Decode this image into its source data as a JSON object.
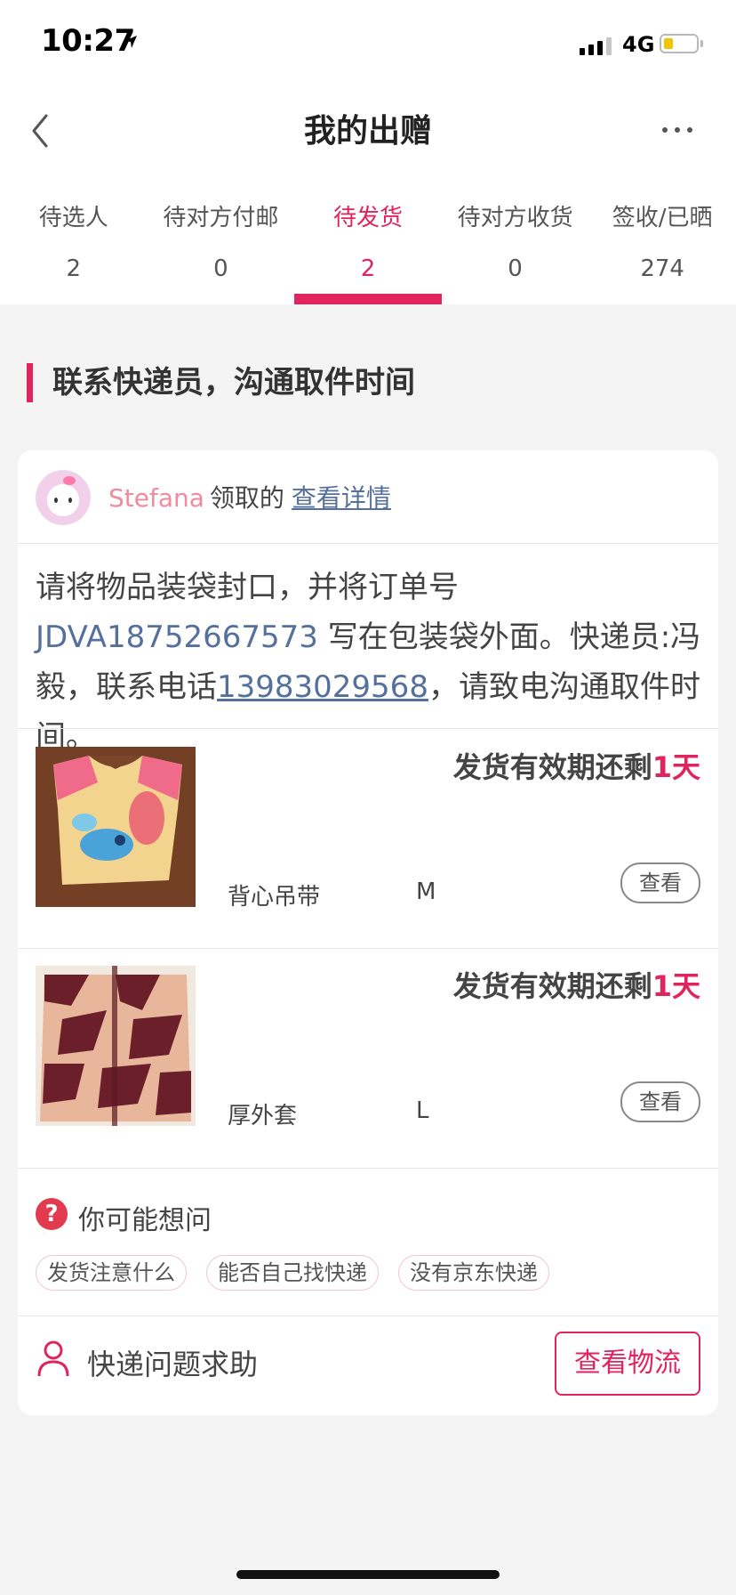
{
  "status_bar": {
    "time": "10:27",
    "network": "4G",
    "battery_color": "#f5c400"
  },
  "nav": {
    "title": "我的出赠",
    "back_icon": "chevron-left-icon",
    "more_icon": "more-dots-icon"
  },
  "tabs": [
    {
      "label": "待选人",
      "count": "2",
      "active": false
    },
    {
      "label": "待对方付邮",
      "count": "0",
      "active": false
    },
    {
      "label": "待发货",
      "count": "2",
      "active": true
    },
    {
      "label": "待对方收货",
      "count": "0",
      "active": false
    },
    {
      "label": "签收/已晒",
      "count": "274",
      "active": false
    }
  ],
  "accent_color": "#e0245e",
  "section_header": "联系快递员，沟通取件时间",
  "claimer": {
    "name": "Stefana",
    "suffix": "领取的",
    "link": "查看详情"
  },
  "instructions": {
    "part1": "请将物品装袋封口，并将订单号 ",
    "order_no": "JDVA18752667573",
    "part2": " 写在包装袋外面。快递员:冯毅，联系电话",
    "phone": "13983029568",
    "part3": "，请致电沟通取件时间。"
  },
  "items": [
    {
      "deadline_prefix": "发货有效期还剩",
      "deadline_days": "1天",
      "name": "背心吊带",
      "size": "M",
      "view_label": "查看"
    },
    {
      "deadline_prefix": "发货有效期还剩",
      "deadline_days": "1天",
      "name": "厚外套",
      "size": "L",
      "view_label": "查看"
    }
  ],
  "faq": {
    "title": "你可能想问",
    "tags": [
      "发货注意什么",
      "能否自己找快递",
      "没有京东快递"
    ]
  },
  "help": {
    "text": "快递问题求助",
    "button": "查看物流"
  }
}
